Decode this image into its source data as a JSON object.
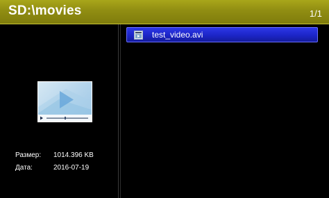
{
  "header": {
    "path": "SD:\\movies",
    "page_indicator": "1/1",
    "background_color": "#8f8c10"
  },
  "preview": {
    "icon": "video-file-icon",
    "size_label": "Размер:",
    "size_value": "1014.396 KB",
    "date_label": "Дата:",
    "date_value": "2016-07-19"
  },
  "file_list": {
    "items": [
      {
        "name": "test_video.avi",
        "icon": "video-file-icon",
        "selected": true
      }
    ],
    "selection_color": "#1f28d0"
  }
}
